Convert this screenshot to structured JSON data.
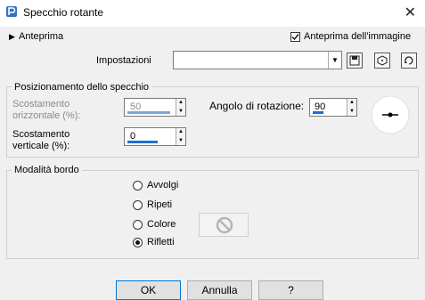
{
  "window": {
    "title": "Specchio rotante",
    "close_glyph": "✕"
  },
  "preview": {
    "toggle_label": "Anteprima",
    "image_preview_label": "Anteprima dell'immagine",
    "image_preview_checked": true
  },
  "presets": {
    "label": "Impostazioni",
    "value": ""
  },
  "mirror_position": {
    "legend": "Posizionamento dello specchio",
    "horizontal_label": "Scostamento\norizzontale (%):",
    "horizontal_value": "50",
    "vertical_label": "Scostamento\nverticale (%):",
    "vertical_value": "0",
    "rotation_label": "Angolo di rotazione:",
    "rotation_value": "90"
  },
  "edge_mode": {
    "legend": "Modalità bordo",
    "options": [
      {
        "label": "Avvolgi",
        "selected": false
      },
      {
        "label": "Ripeti",
        "selected": false
      },
      {
        "label": "Colore",
        "selected": false
      },
      {
        "label": "Rifletti",
        "selected": true
      }
    ]
  },
  "buttons": {
    "ok": "OK",
    "cancel": "Annulla",
    "help": "?"
  },
  "colors": {
    "accent": "#1e6fd0",
    "default_border": "#0078d7"
  }
}
